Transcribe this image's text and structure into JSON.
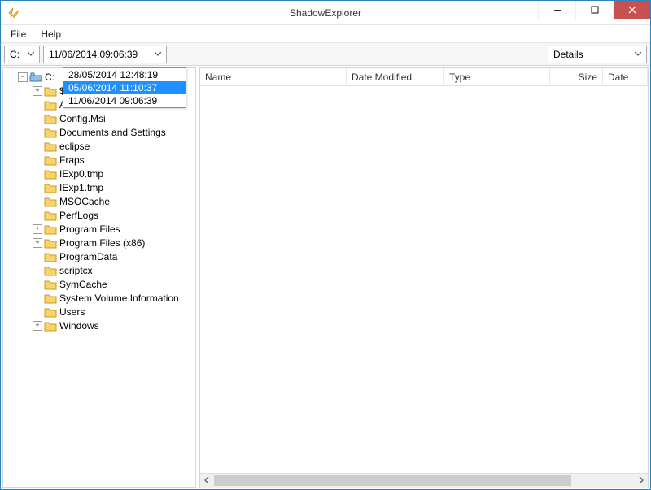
{
  "window": {
    "title": "ShadowExplorer"
  },
  "menubar": {
    "file": "File",
    "help": "Help"
  },
  "toolbar": {
    "drive": "C:",
    "selected_date": "11/06/2014 09:06:39",
    "view_mode": "Details"
  },
  "date_dropdown": {
    "options": [
      {
        "label": "28/05/2014 12:48:19",
        "highlight": false
      },
      {
        "label": "05/06/2014 11:10:37",
        "highlight": true
      },
      {
        "label": "11/06/2014 09:06:39",
        "highlight": false
      }
    ]
  },
  "tree": {
    "root_label": "C:",
    "children": [
      {
        "label": "$Recycle.Bin",
        "expandable": true,
        "hidden_row": true
      },
      {
        "label": "AdwCleaner",
        "expandable": false
      },
      {
        "label": "Config.Msi",
        "expandable": false
      },
      {
        "label": "Documents and Settings",
        "expandable": false
      },
      {
        "label": "eclipse",
        "expandable": false
      },
      {
        "label": "Fraps",
        "expandable": false
      },
      {
        "label": "IExp0.tmp",
        "expandable": false
      },
      {
        "label": "IExp1.tmp",
        "expandable": false
      },
      {
        "label": "MSOCache",
        "expandable": false
      },
      {
        "label": "PerfLogs",
        "expandable": false
      },
      {
        "label": "Program Files",
        "expandable": true
      },
      {
        "label": "Program Files (x86)",
        "expandable": true
      },
      {
        "label": "ProgramData",
        "expandable": false
      },
      {
        "label": "scriptcx",
        "expandable": false
      },
      {
        "label": "SymCache",
        "expandable": false
      },
      {
        "label": "System Volume Information",
        "expandable": false
      },
      {
        "label": "Users",
        "expandable": false
      },
      {
        "label": "Windows",
        "expandable": true
      }
    ]
  },
  "list": {
    "columns": {
      "name": "Name",
      "date_modified": "Date Modified",
      "type": "Type",
      "size": "Size",
      "date": "Date"
    }
  }
}
